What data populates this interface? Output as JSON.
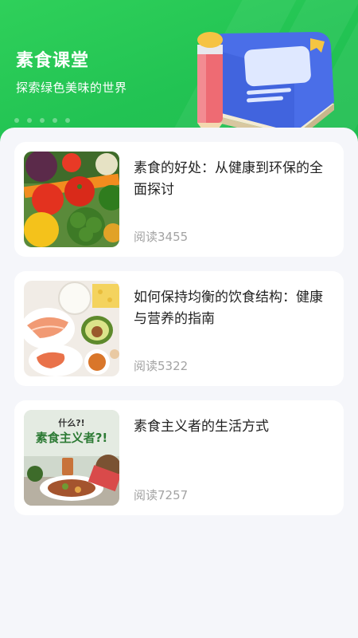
{
  "header": {
    "title": "素食课堂",
    "subtitle": "探索绿色美味的世界",
    "accent": "#22c353",
    "illustration_icon": "book-and-pencil"
  },
  "articles": [
    {
      "title": "素食的好处：从健康到环保的全面探讨",
      "read": "阅读3455",
      "thumb_icon": "vegetables"
    },
    {
      "title": "如何保持均衡的饮食结构：健康与营养的指南",
      "read": "阅读5322",
      "thumb_icon": "balanced-meal"
    },
    {
      "title": "素食主义者的生活方式",
      "read": "阅读7257",
      "thumb_icon": "vegetarian-poster",
      "thumb_text": {
        "small": "什么?!",
        "big": "素食主义者?!"
      }
    }
  ]
}
